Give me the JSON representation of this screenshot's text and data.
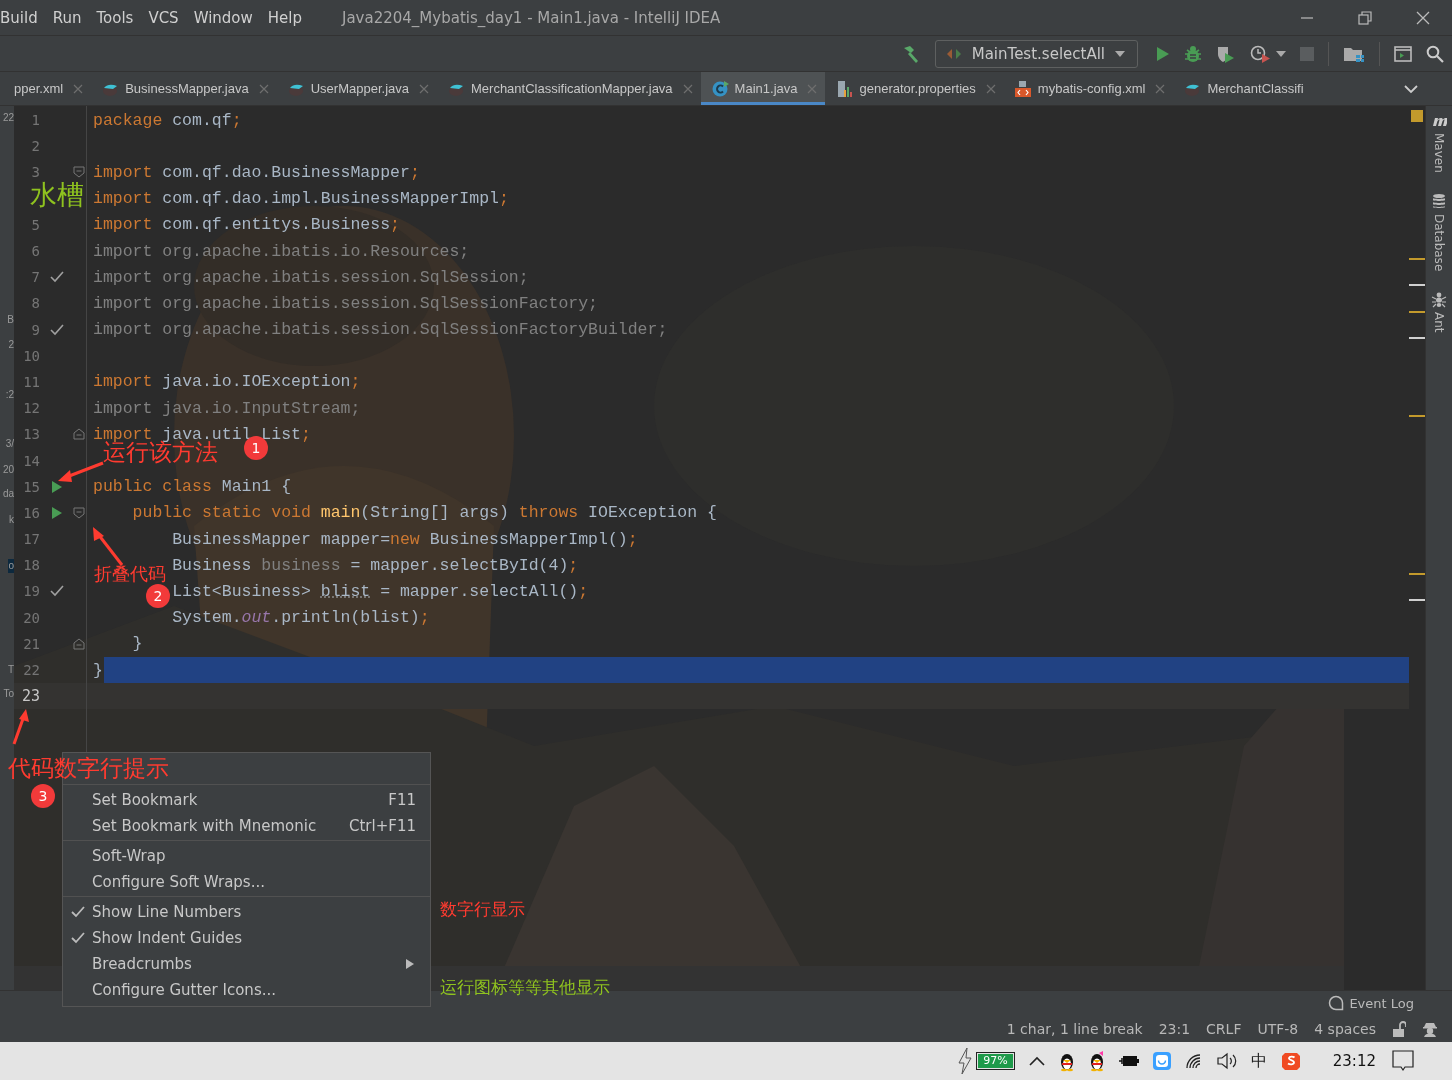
{
  "menu_bar": [
    {
      "label": "Build"
    },
    {
      "label": "Run"
    },
    {
      "label": "Tools"
    },
    {
      "label": "VCS"
    },
    {
      "label": "Window"
    },
    {
      "label": "Help"
    }
  ],
  "window": {
    "title": "Java2204_Mybatis_day1 - Main1.java - IntelliJ IDEA"
  },
  "toolbar": {
    "run_configuration": "MainTest.selectAll"
  },
  "tabs": [
    {
      "label": "pper.xml",
      "kind": "none",
      "selected": false,
      "closable": true
    },
    {
      "label": "BusinessMapper.java",
      "kind": "mapper",
      "selected": false,
      "closable": true
    },
    {
      "label": "UserMapper.java",
      "kind": "mapper",
      "selected": false,
      "closable": true
    },
    {
      "label": "MerchantClassificationMapper.java",
      "kind": "mapper",
      "selected": false,
      "closable": true
    },
    {
      "label": "Main1.java",
      "kind": "class",
      "selected": true,
      "closable": true
    },
    {
      "label": "generator.properties",
      "kind": "properties",
      "selected": false,
      "closable": true
    },
    {
      "label": "mybatis-config.xml",
      "kind": "xml",
      "selected": false,
      "closable": true
    },
    {
      "label": "MerchantClassifi",
      "kind": "mapper",
      "selected": false,
      "closable": false
    }
  ],
  "side_panel_fragments": [
    {
      "text": "22"
    },
    {
      "text": "B"
    },
    {
      "text": "2"
    },
    {
      "text": ":2"
    },
    {
      "text": "3/"
    },
    {
      "text": "20"
    },
    {
      "text": "da"
    },
    {
      "text": "k"
    },
    {
      "text": "o"
    },
    {
      "text": "T"
    },
    {
      "text": "To"
    }
  ],
  "editor": {
    "lines": [
      {
        "number": "1",
        "tokens": [
          {
            "text": "package",
            "kind": "keyword"
          },
          {
            "text": " com.qf",
            "kind": "plain"
          },
          {
            "text": ";",
            "kind": "keyword"
          }
        ]
      },
      {
        "number": "2"
      },
      {
        "number": "3",
        "fold": {
          "kind": "start"
        },
        "tokens": [
          {
            "text": "import",
            "kind": "keyword"
          },
          {
            "text": " com.qf.dao.BusinessMapper",
            "kind": "plain"
          },
          {
            "text": ";",
            "kind": "keyword"
          }
        ]
      },
      {
        "tokens": [
          {
            "text": "import",
            "kind": "keyword"
          },
          {
            "text": " com.qf.dao.impl.BusinessMapperImpl",
            "kind": "plain"
          },
          {
            "text": ";",
            "kind": "keyword"
          }
        ]
      },
      {
        "number": "5",
        "tokens": [
          {
            "text": "import",
            "kind": "keyword"
          },
          {
            "text": " com.qf.entitys.Business",
            "kind": "plain"
          },
          {
            "text": ";",
            "kind": "keyword"
          }
        ]
      },
      {
        "number": "6",
        "tokens": [
          {
            "text": "import org.apache.ibatis.io.Resources;",
            "kind": "unused"
          }
        ]
      },
      {
        "number": "7",
        "gutter": {
          "kind": "check"
        },
        "tokens": [
          {
            "text": "import org.apache.ibatis.session.SqlSession;",
            "kind": "unused"
          }
        ]
      },
      {
        "number": "8",
        "tokens": [
          {
            "text": "import org.apache.ibatis.session.SqlSessionFactory;",
            "kind": "unused"
          }
        ]
      },
      {
        "number": "9",
        "gutter": {
          "kind": "check"
        },
        "tokens": [
          {
            "text": "import org.apache.ibatis.session.SqlSessionFactoryBuilder;",
            "kind": "unused"
          }
        ]
      },
      {
        "number": "10"
      },
      {
        "number": "11",
        "tokens": [
          {
            "text": "import",
            "kind": "keyword"
          },
          {
            "text": " java.io.IOException",
            "kind": "plain"
          },
          {
            "text": ";",
            "kind": "keyword"
          }
        ]
      },
      {
        "number": "12",
        "tokens": [
          {
            "text": "import java.io.InputStream;",
            "kind": "unused"
          }
        ]
      },
      {
        "number": "13",
        "fold": {
          "kind": "end"
        },
        "tokens": [
          {
            "text": "import",
            "kind": "keyword"
          },
          {
            "text": " java.util.List",
            "kind": "plain"
          },
          {
            "text": ";",
            "kind": "keyword"
          }
        ]
      },
      {
        "number": "14"
      },
      {
        "number": "15",
        "gutter": {
          "kind": "run"
        },
        "tokens": [
          {
            "text": "public class ",
            "kind": "keyword"
          },
          {
            "text": "Main1 {",
            "kind": "plain"
          }
        ]
      },
      {
        "number": "16",
        "gutter": {
          "kind": "run"
        },
        "fold": {
          "kind": "start"
        },
        "tokens": [
          {
            "text": "    public static void ",
            "kind": "keyword"
          },
          {
            "text": "main",
            "kind": "method"
          },
          {
            "text": "(String[] args) ",
            "kind": "plain"
          },
          {
            "text": "throws",
            "kind": "keyword"
          },
          {
            "text": " IOException {",
            "kind": "plain"
          }
        ]
      },
      {
        "number": "17",
        "tokens": [
          {
            "text": "        BusinessMapper mapper=",
            "kind": "plain"
          },
          {
            "text": "new",
            "kind": "keyword"
          },
          {
            "text": " BusinessMapperImpl()",
            "kind": "plain"
          },
          {
            "text": ";",
            "kind": "keyword"
          }
        ]
      },
      {
        "number": "18",
        "tokens": [
          {
            "text": "        Business ",
            "kind": "plain"
          },
          {
            "text": "business",
            "kind": "unused"
          },
          {
            "text": " = mapper.selectById(4)",
            "kind": "plain"
          },
          {
            "text": ";",
            "kind": "keyword"
          }
        ]
      },
      {
        "number": "19",
        "gutter": {
          "kind": "check"
        },
        "tokens": [
          {
            "text": "        List<Business> ",
            "kind": "plain"
          },
          {
            "text": "blist",
            "kind": "typo"
          },
          {
            "text": " = mapper.selectAll()",
            "kind": "plain"
          },
          {
            "text": ";",
            "kind": "keyword"
          }
        ]
      },
      {
        "number": "20",
        "tokens": [
          {
            "text": "        System.",
            "kind": "plain"
          },
          {
            "text": "out",
            "kind": "field"
          },
          {
            "text": ".println(blist)",
            "kind": "plain"
          },
          {
            "text": ";",
            "kind": "keyword"
          }
        ]
      },
      {
        "number": "21",
        "fold": {
          "kind": "end"
        },
        "tokens": [
          {
            "text": "    }",
            "kind": "plain"
          }
        ]
      },
      {
        "number": "22",
        "highlight": {
          "kind": "selection"
        },
        "tokens": [
          {
            "text": "}",
            "kind": "plain"
          }
        ]
      },
      {
        "number": "23",
        "highlight": {
          "kind": "current"
        }
      }
    ]
  },
  "error_stripe": [
    {
      "color": "#c39a2c"
    },
    {
      "color": "#d0d0d0"
    },
    {
      "color": "#c39a2c"
    },
    {
      "color": "#d0d0d0"
    },
    {
      "color": "#c39a2c"
    },
    {
      "color": "#c39a2c"
    },
    {
      "color": "#d0d0d0"
    }
  ],
  "tool_windows": [
    {
      "label": "Maven",
      "kind": "maven"
    },
    {
      "label": "Database",
      "kind": "database"
    },
    {
      "label": "Ant",
      "kind": "ant"
    }
  ],
  "context_menu": {
    "groups": [
      [
        {
          "label": "Set Bookmark",
          "shortcut": "F11",
          "checked": false
        },
        {
          "label": "Set Bookmark with Mnemonic",
          "shortcut": "Ctrl+F11",
          "checked": false
        }
      ],
      [
        {
          "label": "Soft-Wrap",
          "checked": false
        },
        {
          "label": "Configure Soft Wraps...",
          "checked": false
        }
      ],
      [
        {
          "label": "Show Line Numbers",
          "checked": true
        },
        {
          "label": "Show Indent Guides",
          "checked": true
        },
        {
          "label": "Breadcrumbs",
          "checked": false,
          "submenu": true
        },
        {
          "label": "Configure Gutter Icons...",
          "checked": false
        }
      ]
    ]
  },
  "annotations": [
    {
      "text": "水槽",
      "color": "#8fc31f"
    },
    {
      "text": "运行该方法",
      "color": "#ff3b30",
      "badge": "1"
    },
    {
      "text": "折叠代码",
      "color": "#ff3b30",
      "badge": "2"
    },
    {
      "text": "代码数字行提示",
      "color": "#ff3b30",
      "badge": "3"
    },
    {
      "text": "数字行显示",
      "color": "#ff3b30"
    },
    {
      "text": "运行图标等等其他显示",
      "color": "#8fc31f"
    }
  ],
  "event_log": "Event Log",
  "status_bar": [
    {
      "text": "1 char, 1 line break"
    },
    {
      "text": "23:1"
    },
    {
      "text": "CRLF"
    },
    {
      "text": "UTF-8"
    },
    {
      "text": "4 spaces"
    }
  ],
  "taskbar": {
    "battery": "97%",
    "ime": "中",
    "time": "23:12"
  }
}
